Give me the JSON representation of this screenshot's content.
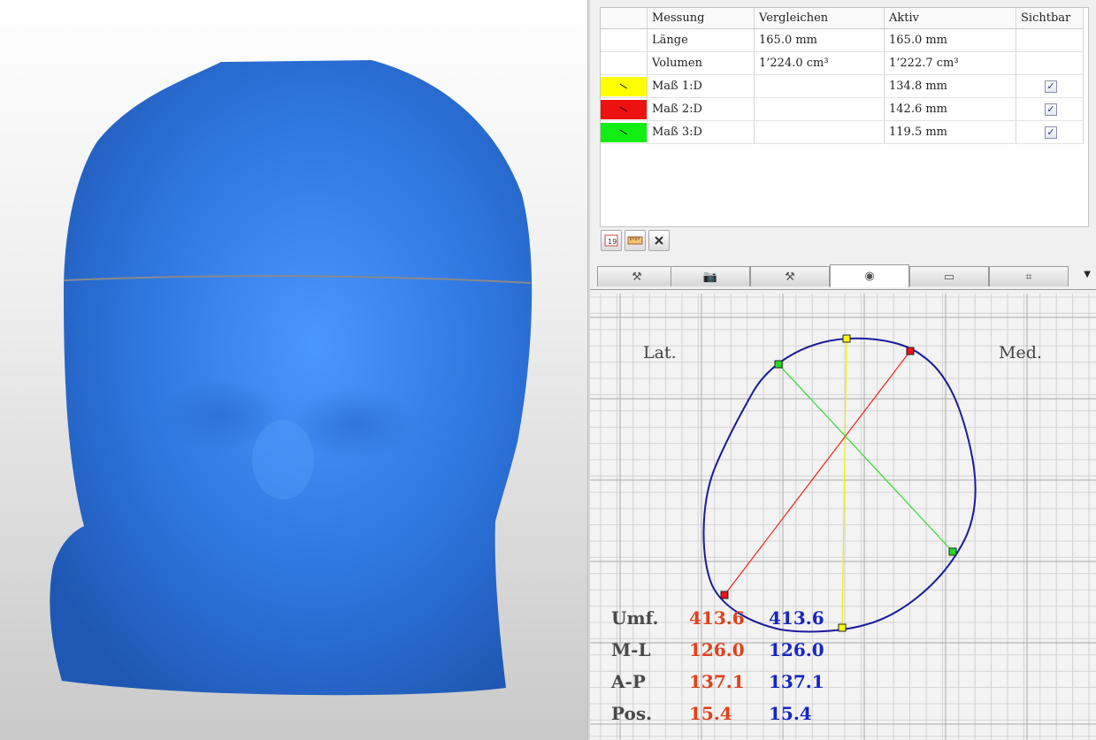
{
  "table": {
    "headers": [
      "",
      "Messung",
      "Vergleichen",
      "Aktiv",
      "Sichtbar"
    ],
    "rows": [
      {
        "name": "Länge",
        "compare": "165.0 mm",
        "active": "165.0 mm",
        "color": "",
        "visible": null
      },
      {
        "name": "Volumen",
        "compare": "1’224.0 cm³",
        "active": "1’222.7 cm³",
        "color": "",
        "visible": null
      },
      {
        "name": "Maß 1:D",
        "compare": "",
        "active": "134.8 mm",
        "color": "#ffff00",
        "visible": true
      },
      {
        "name": "Maß 2:D",
        "compare": "",
        "active": "142.6 mm",
        "color": "#ee1111",
        "visible": true
      },
      {
        "name": "Maß 3:D",
        "compare": "",
        "active": "119.5 mm",
        "color": "#11ee11",
        "visible": true
      }
    ],
    "swatch_glyph": "\\",
    "check_glyph": "✓"
  },
  "toolbar": {
    "icons": [
      "measure-icon",
      "ruler-icon",
      "delete-icon"
    ]
  },
  "tabs": [
    {
      "icon": "tools-icon",
      "glyph": "⚒"
    },
    {
      "icon": "camera-icon",
      "glyph": "📷"
    },
    {
      "icon": "hammer-icon",
      "glyph": "⚒"
    },
    {
      "icon": "cylinder-icon",
      "glyph": "◉"
    },
    {
      "icon": "note-icon",
      "glyph": "▭"
    },
    {
      "icon": "tree-icon",
      "glyph": "⌗"
    }
  ],
  "tab_menu_glyph": "▼",
  "active_tab": 3,
  "section": {
    "left_label": "Lat.",
    "right_label": "Med.",
    "measurements": [
      {
        "label": "Umf.",
        "compare": "413.6",
        "active": "413.6"
      },
      {
        "label": "M-L",
        "compare": "126.0",
        "active": "126.0"
      },
      {
        "label": "A-P",
        "compare": "137.1",
        "active": "137.1"
      },
      {
        "label": "Pos.",
        "compare": "15.4",
        "active": "15.4"
      }
    ],
    "compare_color": "#e2401b",
    "active_color": "#1525c4"
  },
  "model": {
    "color": "#2f77e0",
    "cut_line_color": "#8a8a8a"
  }
}
